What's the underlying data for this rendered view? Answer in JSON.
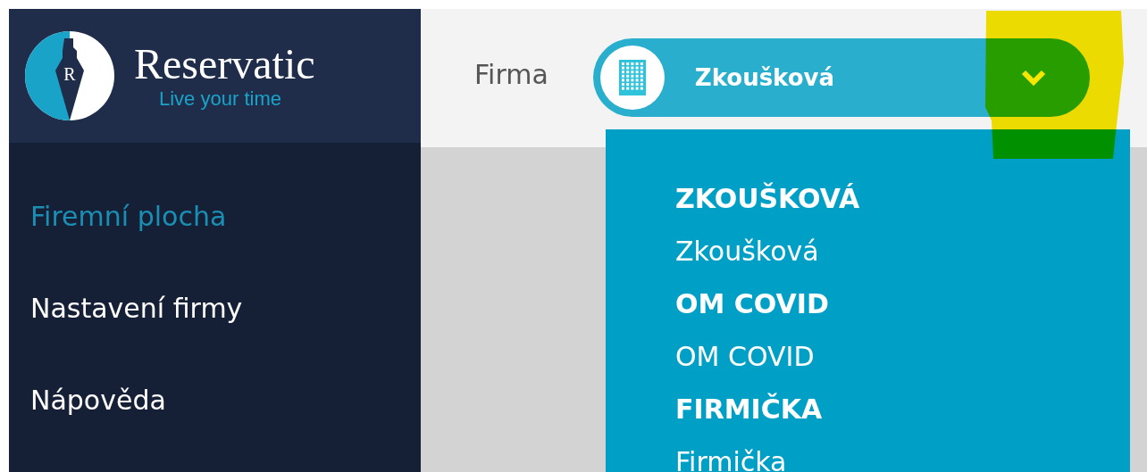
{
  "logo": {
    "name": "Reservatic",
    "tagline": "Live your time",
    "letter": "R"
  },
  "sidebar": {
    "items": [
      {
        "label": "Firemní plocha",
        "selected": true
      },
      {
        "label": "Nastavení firmy",
        "selected": false
      },
      {
        "label": "Nápověda",
        "selected": false
      }
    ]
  },
  "header": {
    "label": "Firma",
    "company_select": {
      "value": "Zkoušková",
      "expanded": true
    }
  },
  "dropdown": {
    "options": [
      {
        "label": "ZKOUŠKOVÁ",
        "kind": "group"
      },
      {
        "label": "Zkoušková",
        "kind": "option"
      },
      {
        "label": "OM COVID",
        "kind": "group"
      },
      {
        "label": "OM COVID",
        "kind": "option"
      },
      {
        "label": "FIRMIČKA",
        "kind": "group"
      },
      {
        "label": "Firmička",
        "kind": "option"
      }
    ]
  }
}
